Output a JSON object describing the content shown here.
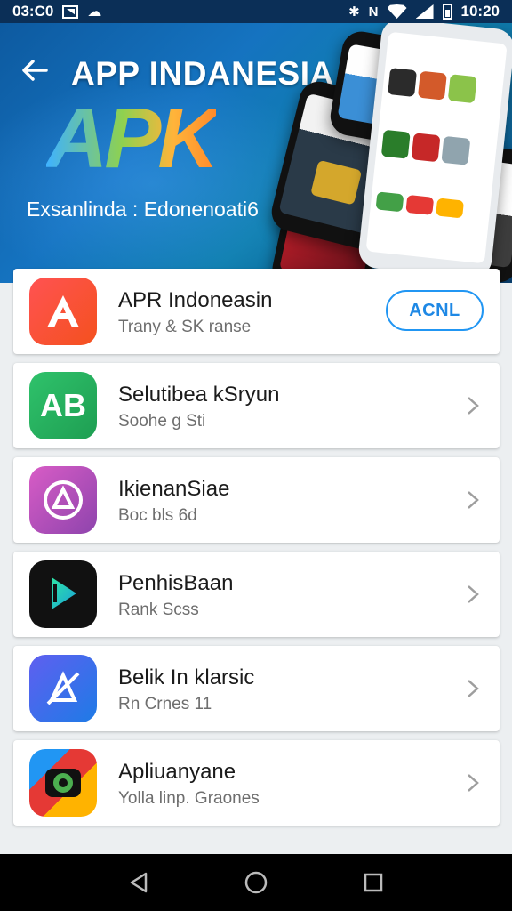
{
  "status_bar": {
    "time": "03:C0",
    "clock": "10:20"
  },
  "header": {
    "title": "APP INDANESIA",
    "logo": "APK",
    "subtitle": "Exsanlinda : Edonenoati6"
  },
  "apps": [
    {
      "name": "APR Indoneasin",
      "subtitle": "Trany & SK  ranse",
      "action": "ACNL",
      "icon": "letter-a-icon"
    },
    {
      "name": "Selutibea kSryun",
      "subtitle": "Soohe g Sti",
      "icon_text": "AB",
      "icon": "ab-icon"
    },
    {
      "name": "IkienanSiae",
      "subtitle": "Boc bls 6d",
      "icon": "circle-a-icon"
    },
    {
      "name": "PenhisBaan",
      "subtitle": "Rank Scss",
      "icon": "play-p-icon"
    },
    {
      "name": "Belik In klarsic",
      "subtitle": "Rn Crnes 11",
      "icon": "crossed-a-icon"
    },
    {
      "name": "Apliuanyane",
      "subtitle": "Yolla linp. Graones",
      "icon": "camera-c-icon"
    }
  ],
  "colors": {
    "accent": "#2196f3",
    "header_start": "#0d5aa0",
    "header_end": "#0c4d86"
  }
}
